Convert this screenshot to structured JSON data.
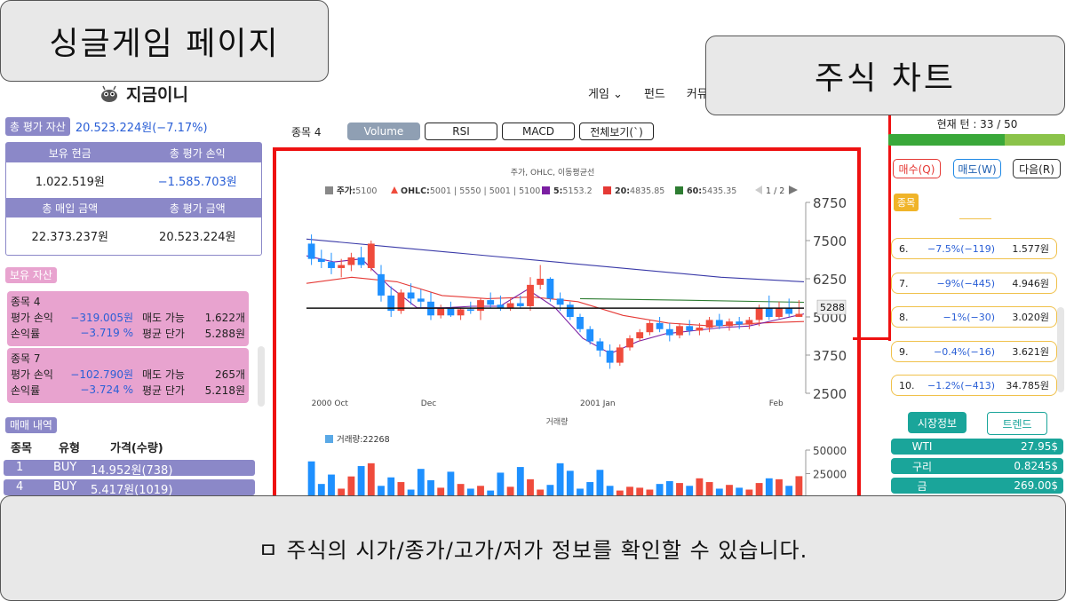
{
  "callouts": {
    "title": "싱글게임 페이지",
    "chart": "주식 차트",
    "bottom": "ㅁ 주식의 시가/종가/고가/저가 정보를 확인할 수 있습니다."
  },
  "nav": {
    "logo": "지금이니",
    "links": [
      "게임 ⌄",
      "펀드",
      "커뮤"
    ]
  },
  "left": {
    "total_label": "총 평가 자산",
    "total_value": "20.523.224원(−7.17%)",
    "summary": {
      "h1": "보유 현금",
      "h2": "총 평가 손익",
      "v1": "1.022.519원",
      "v2": "−1.585.703원",
      "h3": "총 매입 금액",
      "h4": "총 평가 금액",
      "v3": "22.373.237원",
      "v4": "20.523.224원"
    },
    "holdings_label": "보유 자산",
    "holdings": [
      {
        "name": "종목 4",
        "pl_label": "평가 손익",
        "pl": "−319.005원",
        "sell_label": "매도 가능",
        "sell": "1.622개",
        "rate_label": "손익률",
        "rate": "−3.719 %",
        "avg_label": "평균 단가",
        "avg": "5.288원"
      },
      {
        "name": "종목 7",
        "pl_label": "평가 손익",
        "pl": "−102.790원",
        "sell_label": "매도 가능",
        "sell": "265개",
        "rate_label": "손익률",
        "rate": "−3.724 %",
        "avg_label": "평균 단가",
        "avg": "5.218원"
      }
    ],
    "trades_label": "매매 내역",
    "trade_headers": [
      "종목",
      "유형",
      "가격(수량)"
    ],
    "trades": [
      {
        "stock": "1",
        "type": "BUY",
        "price": "14.952원(738)"
      },
      {
        "stock": "4",
        "type": "BUY",
        "price": "5.417원(1019)"
      }
    ]
  },
  "chart": {
    "stock_label": "종목 4",
    "tabs": [
      "Volume",
      "RSI",
      "MACD",
      "전체보기(`)"
    ],
    "title": "주가, OHLC, 이동평균선",
    "legend": {
      "price_label": "주가:",
      "price": "5100",
      "ohlc_label": "OHLC:",
      "ohlc": "5001 | 5550 | 5001 | 5100",
      "ma5_label": "5:",
      "ma5": "5153.2",
      "ma20_label": "20:",
      "ma20": "4835.85",
      "ma60_label": "60:",
      "ma60": "5435.35",
      "page": "1 / 2"
    },
    "current_price_tag": "5288",
    "volume_title": "거래량",
    "volume_legend": "거래량:22268",
    "colors": {
      "up": "#ef4b3c",
      "down": "#1e90ff",
      "ma5": "#7b1fa2",
      "ma20": "#e53935",
      "ma60": "#2e7d32",
      "ma_long": "#3a3aa8"
    }
  },
  "chart_data": [
    {
      "type": "candlestick",
      "title": "주가, OHLC, 이동평균선",
      "x_ticks": [
        "2000 Oct",
        "Dec",
        "2001 Jan",
        "Feb"
      ],
      "y_ticks": [
        2500,
        3750,
        5000,
        6250,
        7500,
        8750
      ],
      "ylim": [
        2500,
        8750
      ],
      "candles": [
        {
          "o": 7400,
          "h": 7700,
          "l": 6700,
          "c": 6900
        },
        {
          "o": 6900,
          "h": 7200,
          "l": 6600,
          "c": 6800
        },
        {
          "o": 6800,
          "h": 7100,
          "l": 6400,
          "c": 6600
        },
        {
          "o": 6600,
          "h": 6900,
          "l": 6300,
          "c": 6700
        },
        {
          "o": 6700,
          "h": 7100,
          "l": 6500,
          "c": 6950
        },
        {
          "o": 6950,
          "h": 7300,
          "l": 6600,
          "c": 6700
        },
        {
          "o": 6600,
          "h": 7500,
          "l": 6500,
          "c": 7400
        },
        {
          "o": 6400,
          "h": 6700,
          "l": 5500,
          "c": 5700
        },
        {
          "o": 5700,
          "h": 6000,
          "l": 5000,
          "c": 5200
        },
        {
          "o": 5200,
          "h": 5900,
          "l": 5100,
          "c": 5800
        },
        {
          "o": 5800,
          "h": 6100,
          "l": 5400,
          "c": 5600
        },
        {
          "o": 5600,
          "h": 5900,
          "l": 5300,
          "c": 5500
        },
        {
          "o": 5500,
          "h": 5800,
          "l": 4900,
          "c": 5050
        },
        {
          "o": 5050,
          "h": 5400,
          "l": 4950,
          "c": 5300
        },
        {
          "o": 5300,
          "h": 5500,
          "l": 5000,
          "c": 5050
        },
        {
          "o": 5050,
          "h": 5300,
          "l": 4900,
          "c": 5250
        },
        {
          "o": 5250,
          "h": 5500,
          "l": 5100,
          "c": 5200
        },
        {
          "o": 5200,
          "h": 5600,
          "l": 4900,
          "c": 5550
        },
        {
          "o": 5550,
          "h": 5800,
          "l": 5300,
          "c": 5400
        },
        {
          "o": 5400,
          "h": 5700,
          "l": 5200,
          "c": 5300
        },
        {
          "o": 5300,
          "h": 5600,
          "l": 5200,
          "c": 5450
        },
        {
          "o": 5450,
          "h": 5700,
          "l": 5300,
          "c": 5350
        },
        {
          "o": 5350,
          "h": 6300,
          "l": 5200,
          "c": 6050
        },
        {
          "o": 6050,
          "h": 6700,
          "l": 5900,
          "c": 6250
        },
        {
          "o": 6250,
          "h": 6300,
          "l": 5500,
          "c": 5600
        },
        {
          "o": 5600,
          "h": 5800,
          "l": 5200,
          "c": 5400
        },
        {
          "o": 5400,
          "h": 5500,
          "l": 4900,
          "c": 5000
        },
        {
          "o": 5000,
          "h": 5100,
          "l": 4500,
          "c": 4600
        },
        {
          "o": 4600,
          "h": 4700,
          "l": 4100,
          "c": 4200
        },
        {
          "o": 4200,
          "h": 4300,
          "l": 3700,
          "c": 3900
        },
        {
          "o": 3900,
          "h": 4100,
          "l": 3300,
          "c": 3500
        },
        {
          "o": 3500,
          "h": 4100,
          "l": 3400,
          "c": 4000
        },
        {
          "o": 4000,
          "h": 4400,
          "l": 3900,
          "c": 4300
        },
        {
          "o": 4300,
          "h": 4600,
          "l": 4200,
          "c": 4500
        },
        {
          "o": 4500,
          "h": 4900,
          "l": 4400,
          "c": 4800
        },
        {
          "o": 4800,
          "h": 5000,
          "l": 4500,
          "c": 4600
        },
        {
          "o": 4600,
          "h": 4800,
          "l": 4200,
          "c": 4400
        },
        {
          "o": 4400,
          "h": 4800,
          "l": 4300,
          "c": 4700
        },
        {
          "o": 4700,
          "h": 4900,
          "l": 4400,
          "c": 4550
        },
        {
          "o": 4550,
          "h": 4800,
          "l": 4400,
          "c": 4650
        },
        {
          "o": 4650,
          "h": 5000,
          "l": 4500,
          "c": 4900
        },
        {
          "o": 4900,
          "h": 5100,
          "l": 4600,
          "c": 4700
        },
        {
          "o": 4700,
          "h": 4950,
          "l": 4550,
          "c": 4850
        },
        {
          "o": 4850,
          "h": 5000,
          "l": 4600,
          "c": 4750
        },
        {
          "o": 4750,
          "h": 5000,
          "l": 4600,
          "c": 4900
        },
        {
          "o": 4900,
          "h": 5400,
          "l": 4700,
          "c": 5300
        },
        {
          "o": 5300,
          "h": 5700,
          "l": 4900,
          "c": 5000
        },
        {
          "o": 5000,
          "h": 5500,
          "l": 4950,
          "c": 5300
        },
        {
          "o": 5300,
          "h": 5600,
          "l": 5000,
          "c": 5100
        },
        {
          "o": 5001,
          "h": 5550,
          "l": 5001,
          "c": 5100
        }
      ],
      "moving_averages": {
        "long": [
          7550,
          7300,
          7050,
          6800,
          6550,
          6300,
          6150
        ],
        "ma20": [
          6100,
          6300,
          6150,
          5700,
          5600,
          5650,
          5500,
          5050,
          4800,
          4700,
          4800,
          4850
        ],
        "ma5": [
          7000,
          6800,
          6900,
          6000,
          5300,
          5300,
          5350,
          5350,
          5900,
          5300,
          4300,
          3800,
          4200,
          4450,
          4550,
          4650,
          4700,
          4900,
          5100
        ]
      },
      "horizontal_line": 5288
    },
    {
      "type": "bar",
      "title": "거래량",
      "y_ticks": [
        25000,
        50000
      ],
      "ylim": [
        0,
        50000
      ],
      "values": [
        38000,
        14000,
        24000,
        9000,
        22000,
        33000,
        36000,
        12000,
        21000,
        16000,
        8000,
        30000,
        18000,
        10000,
        27000,
        14000,
        9000,
        12000,
        7000,
        26000,
        11000,
        32000,
        19000,
        8000,
        13000,
        36000,
        28000,
        9000,
        16000,
        29000,
        12000,
        7000,
        11000,
        10000,
        8000,
        14000,
        17000,
        15000,
        12000,
        20000,
        16000,
        9000,
        13000,
        10000,
        8000,
        15000,
        20000,
        19000,
        12000,
        22268
      ]
    }
  ],
  "right": {
    "turn": "현재 턴 : 33 / 50",
    "turn_progress": 0.66,
    "buttons": [
      "매수(Q)",
      "매도(W)",
      "다음(R)"
    ],
    "stock_tag": "종목",
    "ranks": [
      {
        "no": "6.",
        "change": "−7.5%(−119)",
        "price": "1.577원"
      },
      {
        "no": "7.",
        "change": "−9%(−445)",
        "price": "4.946원"
      },
      {
        "no": "8.",
        "change": "−1%(−30)",
        "price": "3.020원"
      },
      {
        "no": "9.",
        "change": "−0.4%(−16)",
        "price": "3.621원"
      },
      {
        "no": "10.",
        "change": "−1.2%(−413)",
        "price": "34.785원"
      }
    ],
    "tabs": [
      "시장정보",
      "트렌드"
    ],
    "market": [
      {
        "name": "WTI",
        "value": "27.95$"
      },
      {
        "name": "구리",
        "value": "0.8245$"
      },
      {
        "name": "금",
        "value": "269.00$"
      }
    ]
  }
}
